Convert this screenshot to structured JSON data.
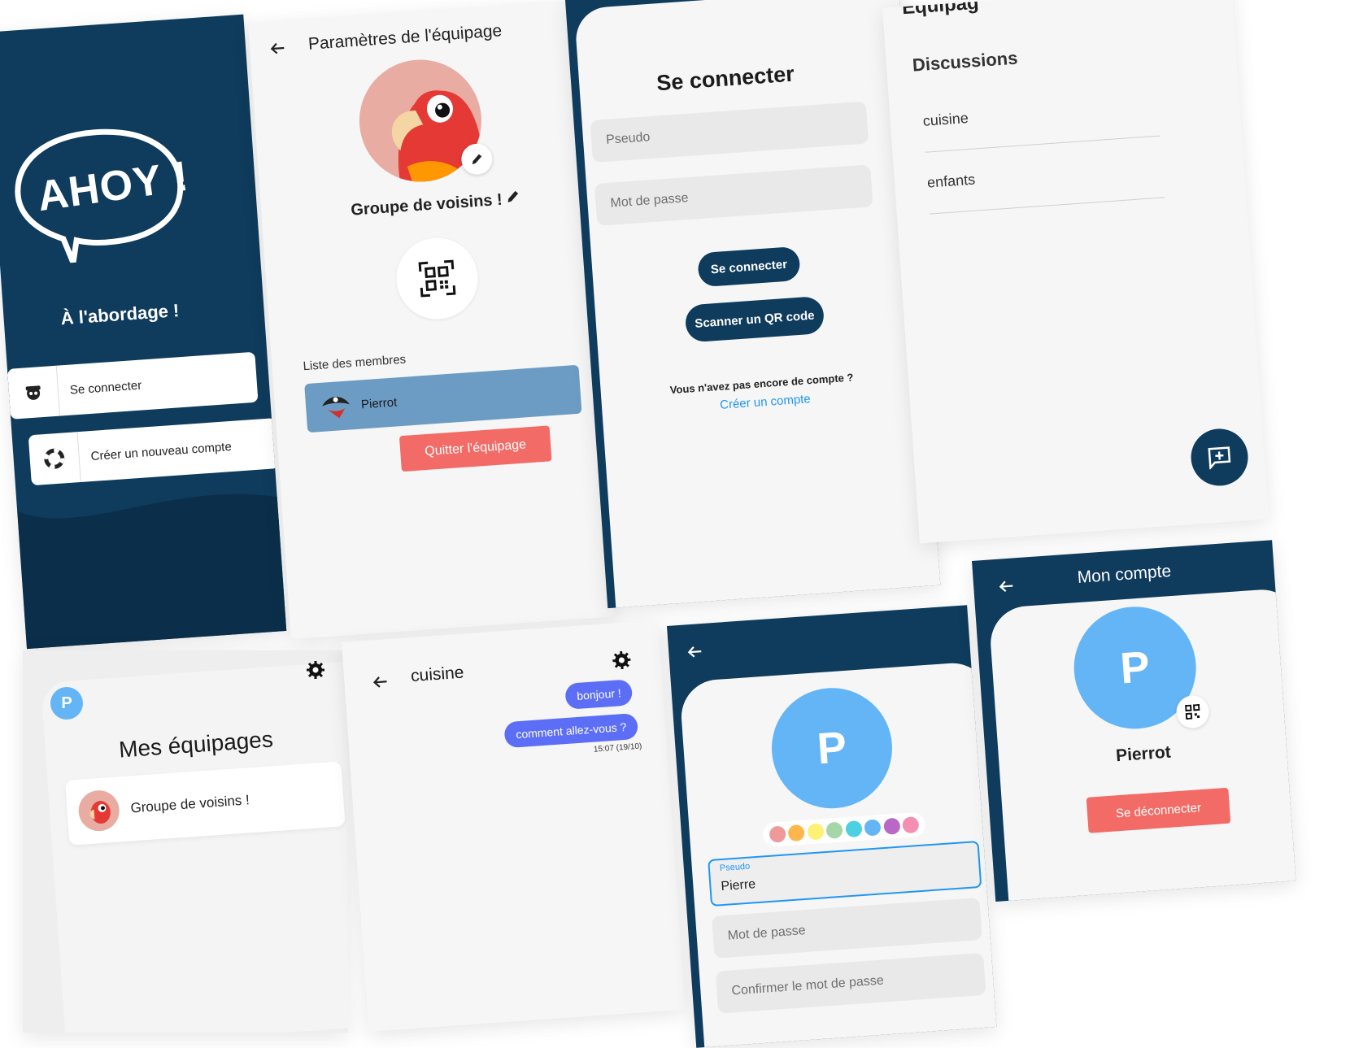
{
  "welcome": {
    "logo_text": "AHOY !",
    "tagline": "À l'abordage !",
    "login_button": "Se connecter",
    "create_button": "Créer un nouveau compte"
  },
  "crew_settings": {
    "title": "Paramètres de l'équipage",
    "group_name": "Groupe de voisins !",
    "members_label": "Liste des membres",
    "member_name": "Pierrot",
    "leave_button": "Quitter l'équipage"
  },
  "login": {
    "title": "Se connecter",
    "username_placeholder": "Pseudo",
    "password_placeholder": "Mot de passe",
    "login_button": "Se connecter",
    "scan_button": "Scanner un QR code",
    "no_account_text": "Vous n'avez pas encore de compte ?",
    "create_link": "Créer un compte"
  },
  "discussions": {
    "header_partial": "Équipag",
    "title": "Discussions",
    "items": [
      "cuisine",
      "enfants"
    ]
  },
  "my_crews": {
    "avatar_letter": "P",
    "title": "Mes équipages",
    "group_name": "Groupe de voisins !"
  },
  "chat": {
    "title": "cuisine",
    "messages": [
      "bonjour !",
      "comment allez-vous ?"
    ],
    "timestamp": "15:07 (19/10)"
  },
  "signup": {
    "avatar_letter": "P",
    "username_label": "Pseudo",
    "username_value": "Pierre",
    "password_placeholder": "Mot de passe",
    "confirm_placeholder": "Confirmer le mot de passe",
    "colors": [
      "#ef9a9a",
      "#ffb74d",
      "#fff176",
      "#a5d6a7",
      "#4dd0e1",
      "#64b5f6",
      "#ba68c8",
      "#f48fb1"
    ]
  },
  "account": {
    "title": "Mon compte",
    "avatar_letter": "P",
    "name": "Pierrot",
    "logout_button": "Se déconnecter"
  },
  "theme": {
    "navy": "#0f3b5c",
    "steel_blue": "#6c9bc4",
    "coral": "#f26b66",
    "violet": "#5b6ef5",
    "link": "#2196f3",
    "avatar_blue": "#64b5f6"
  }
}
